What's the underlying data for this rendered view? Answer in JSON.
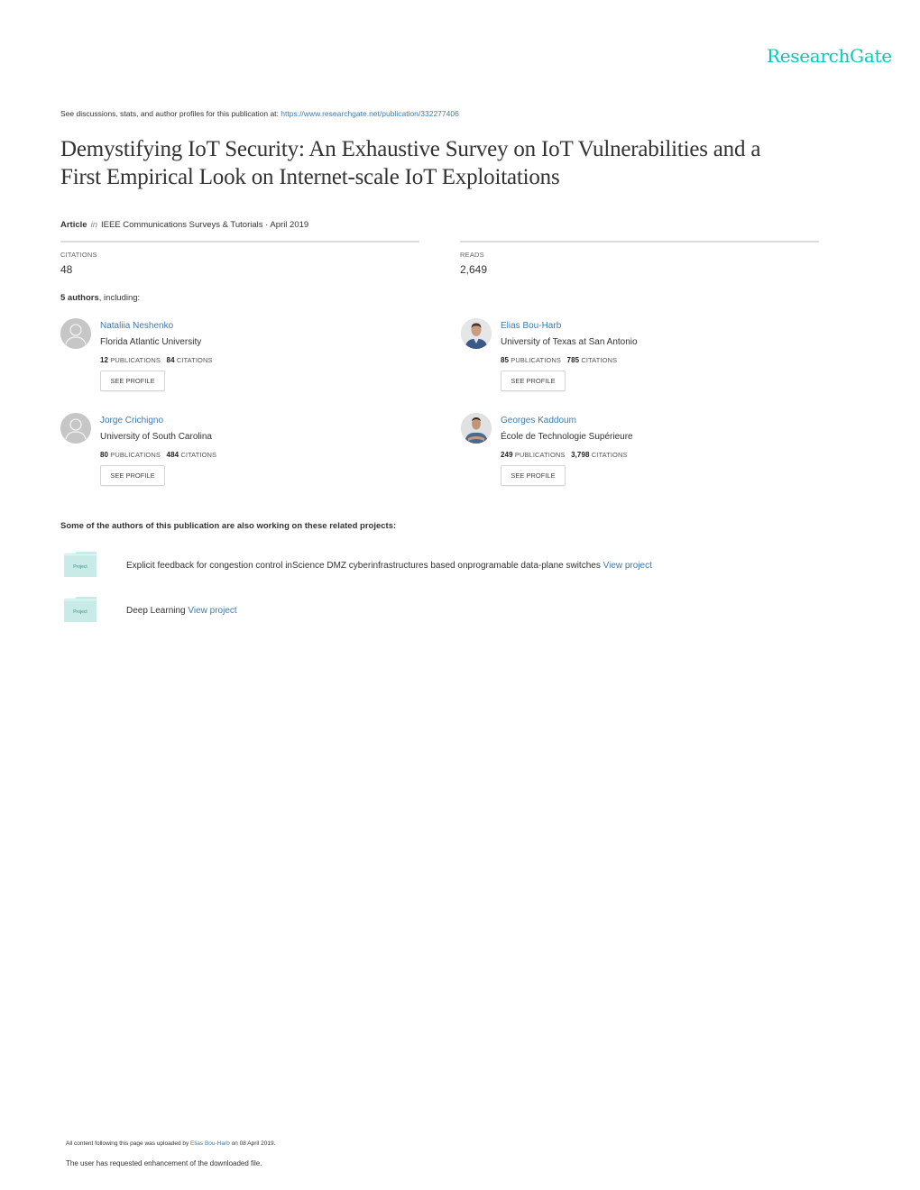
{
  "header": {
    "logo": "ResearchGate",
    "see_text": "See discussions, stats, and author profiles for this publication at: ",
    "see_link": "https://www.researchgate.net/publication/332277406"
  },
  "publication": {
    "title_line1": "Demystifying IoT Security: An Exhaustive Survey on IoT Vulnerabilities and a",
    "title_line2": "First Empirical Look on Internet-scale IoT Exploitations",
    "type": "Article",
    "in_label": "in",
    "venue": "IEEE Communications Surveys & Tutorials · April 2019"
  },
  "stats": {
    "citations_label": "CITATIONS",
    "citations_value": "48",
    "reads_label": "READS",
    "reads_value": "2,649"
  },
  "authors_summary": {
    "count_label": "5 authors",
    "suffix": ", including:"
  },
  "authors": [
    {
      "name": "Nataliia Neshenko",
      "institution": "Florida Atlantic University",
      "publications": "12",
      "citations": "84",
      "avatar": "placeholder"
    },
    {
      "name": "Elias Bou-Harb",
      "institution": "University of Texas at San Antonio",
      "publications": "85",
      "citations": "785",
      "avatar": "photo"
    },
    {
      "name": "Jorge Crichigno",
      "institution": "University of South Carolina",
      "publications": "80",
      "citations": "484",
      "avatar": "placeholder"
    },
    {
      "name": "Georges Kaddoum",
      "institution": "École de Technologie Supérieure",
      "publications": "249",
      "citations": "3,798",
      "avatar": "photo"
    }
  ],
  "labels": {
    "publications": "PUBLICATIONS",
    "citations": "CITATIONS",
    "see_profile": "SEE PROFILE"
  },
  "projects": {
    "heading": "Some of the authors of this publication are also working on these related projects:",
    "folder_label": "Project",
    "items": [
      {
        "title": "Explicit feedback for congestion control inScience DMZ cyberinfrastructures based onprogramable data-plane switches",
        "link": "View project"
      },
      {
        "title": "Deep Learning",
        "link": "View project"
      }
    ]
  },
  "footer": {
    "uploaded_prefix": "All content following this page was uploaded by ",
    "uploaded_by": "Elias Bou-Harb",
    "uploaded_suffix": " on 08 April 2019.",
    "enhancement": "The user has requested enhancement of the downloaded file."
  },
  "colors": {
    "brand": "#00ccbb",
    "link": "#3d7aae"
  }
}
